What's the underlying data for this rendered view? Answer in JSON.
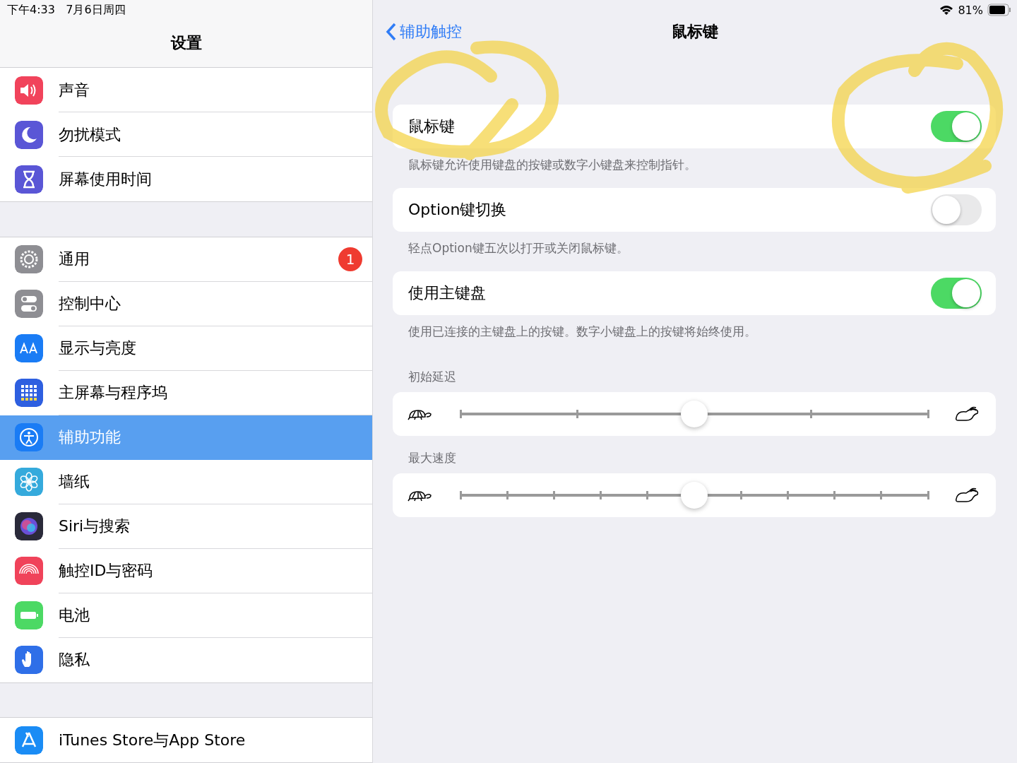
{
  "status_bar": {
    "time": "下午4:33",
    "date": "7月6日周四",
    "battery": "81%"
  },
  "sidebar": {
    "title": "设置",
    "groups": [
      [
        {
          "label": "声音",
          "color": "#f1435b",
          "selected": false
        },
        {
          "label": "勿扰模式",
          "color": "#5a56d6",
          "selected": false
        },
        {
          "label": "屏幕使用时间",
          "color": "#5a56d6",
          "selected": false
        }
      ],
      [
        {
          "label": "通用",
          "color": "#8e8e93",
          "selected": false,
          "badge": "1"
        },
        {
          "label": "控制中心",
          "color": "#8e8e93",
          "selected": false
        },
        {
          "label": "显示与亮度",
          "color": "#1a7cf5",
          "selected": false
        },
        {
          "label": "主屏幕与程序坞",
          "color": "#2e5fe0",
          "selected": false
        },
        {
          "label": "辅助功能",
          "color": "#1a7cf5",
          "selected": true
        },
        {
          "label": "墙纸",
          "color": "#35aadc",
          "selected": false
        },
        {
          "label": "Siri与搜索",
          "color": "#2a2a3a",
          "selected": false
        },
        {
          "label": "触控ID与密码",
          "color": "#f0435a",
          "selected": false
        },
        {
          "label": "电池",
          "color": "#4cd964",
          "selected": false
        },
        {
          "label": "隐私",
          "color": "#2f6fe8",
          "selected": false
        }
      ],
      [
        {
          "label": "iTunes Store与App Store",
          "color": "#1a8cf5",
          "selected": false
        }
      ]
    ]
  },
  "detail": {
    "back": "辅助触控",
    "title": "鼠标键",
    "sections": [
      {
        "kind": "toggle",
        "label": "鼠标键",
        "on": true,
        "footer": "鼠标键允许使用键盘的按键或数字小键盘来控制指针。"
      },
      {
        "kind": "toggle",
        "label": "Option键切换",
        "on": false,
        "footer": "轻点Option键五次以打开或关闭鼠标键。"
      },
      {
        "kind": "toggle",
        "label": "使用主键盘",
        "on": true,
        "footer": "使用已连接的主键盘上的按键。数字小键盘上的按键将始终使用。"
      },
      {
        "kind": "slider",
        "header": "初始延迟",
        "level": 0.5
      },
      {
        "kind": "slider",
        "header": "最大速度",
        "level": 0.5
      }
    ]
  }
}
